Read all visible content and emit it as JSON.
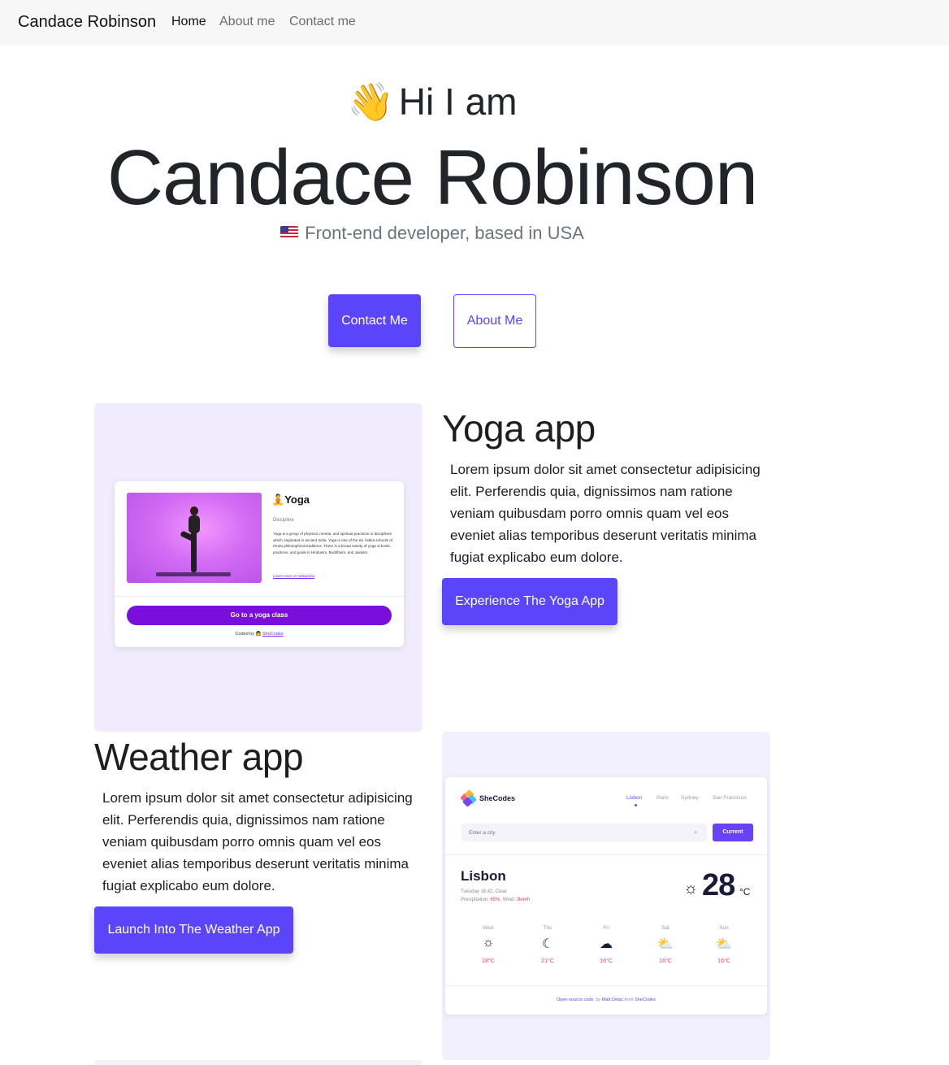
{
  "nav": {
    "brand": "Candace Robinson",
    "links": [
      "Home",
      "About me",
      "Contact me"
    ]
  },
  "hero": {
    "wave_icon": "👋",
    "greeting": "Hi I am",
    "name": "Candace Robinson",
    "flag_icon": "us-flag-icon",
    "subtitle": "Front-end developer, based in USA",
    "contact_button": "Contact Me",
    "about_button": "About Me"
  },
  "colors": {
    "accent": "#5b45fa",
    "panel": "#f1ecfd",
    "yoga_button": "#7a0fdc",
    "weather_accent": "#6a42f5",
    "weather_highlight": "#ea3d6e"
  },
  "projects": [
    {
      "title": "Yoga app",
      "text": "Lorem ipsum dolor sit amet consectetur adipisicing elit. Perferendis quia, dignissimos nam ratione veniam quibusdam porro omnis quam vel eos eveniet alias temporibus deserunt veritatis minima fugiat explicabo eum dolore.",
      "button": "Experience The Yoga App"
    },
    {
      "title": "Weather app",
      "text": "Lorem ipsum dolor sit amet consectetur adipisicing elit. Perferendis quia, dignissimos nam ratione veniam quibusdam porro omnis quam vel eos eveniet alias temporibus deserunt veritatis minima fugiat explicabo eum dolore.",
      "button": "Launch Into The Weather App"
    }
  ],
  "yoga_preview": {
    "title_icon": "🧘",
    "title": "Yoga",
    "discipline": "Discipline",
    "description": "Yoga is a group of physical, mental, and spiritual practices or disciplines which originated in ancient India. Yoga is one of the six Āstika schools of Hindu philosophical traditions. There is a broad variety of yoga schools, practices, and goals in Hinduism, Buddhism, and Jainism.",
    "wiki_link": "Learn more on Wikipedia",
    "button": "Go to a yoga class",
    "credit_prefix": "Coded by 👩",
    "credit_link": "SheCodes"
  },
  "weather_preview": {
    "brand": "SheCodes",
    "cities": [
      "Lisbon",
      "Paris",
      "Sydney",
      "San Francisco"
    ],
    "search_placeholder": "Enter a city",
    "current_button": "Current",
    "city": "Lisbon",
    "meta_line1": "Tuesday 16:42, Clear",
    "precip_label": "Precipitation: ",
    "precip_value": "65%",
    "wind_label": ", Wind: ",
    "wind_value": "3km/h",
    "temp": "28",
    "unit": "°C",
    "forecast": [
      {
        "day": "Wed",
        "icon": "☼",
        "temp": "28°C"
      },
      {
        "day": "Thu",
        "icon": "☾",
        "temp": "21°C"
      },
      {
        "day": "Fri",
        "icon": "☁",
        "temp": "16°C"
      },
      {
        "day": "Sat",
        "icon": "⛅",
        "temp": "16°C"
      },
      {
        "day": "Sun",
        "icon": "⛅",
        "temp": "16°C"
      }
    ],
    "footer_link": "Open-source code",
    "footer_mid": ", by ",
    "footer_author": "Matt Delac",
    "footer_from": " from ",
    "footer_org": "SheCodes"
  }
}
